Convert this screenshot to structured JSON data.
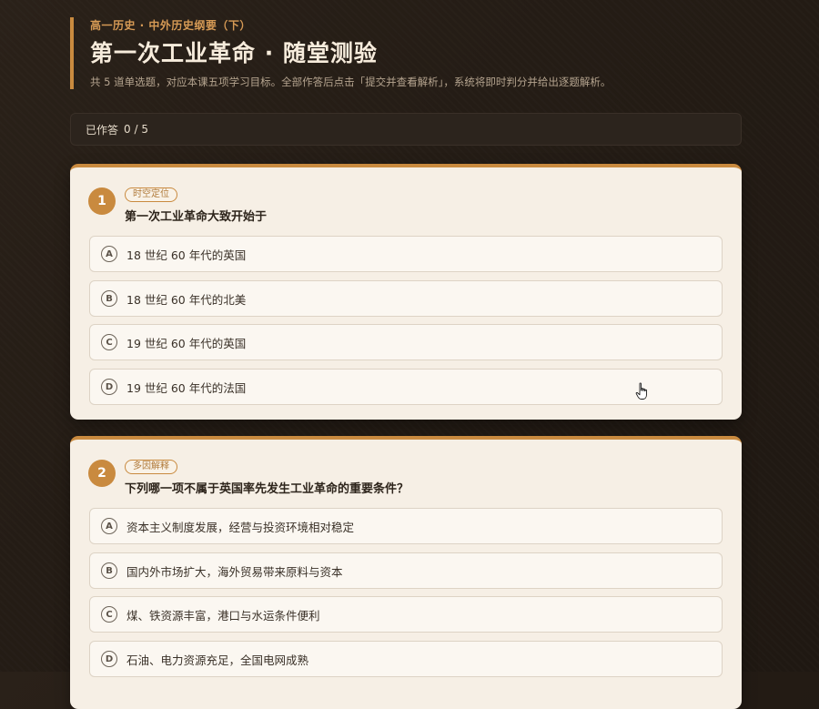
{
  "header": {
    "course": "高一历史 · 中外历史纲要（下）",
    "title": "第一次工业革命 · 随堂测验",
    "subtitle": "共 5 道单选题，对应本课五项学习目标。全部作答后点击「提交并查看解析」，系统将即时判分并给出逐题解析。"
  },
  "progress": {
    "label": "已作答",
    "value": "0 / 5"
  },
  "questions": [
    {
      "number": "1",
      "tag": "时空定位",
      "text": "第一次工业革命大致开始于",
      "options": [
        {
          "letter": "A",
          "text": "18 世纪 60 年代的英国"
        },
        {
          "letter": "B",
          "text": "18 世纪 60 年代的北美"
        },
        {
          "letter": "C",
          "text": "19 世纪 60 年代的英国"
        },
        {
          "letter": "D",
          "text": "19 世纪 60 年代的法国"
        }
      ]
    },
    {
      "number": "2",
      "tag": "多因解释",
      "text": "下列哪一项不属于英国率先发生工业革命的重要条件？",
      "options": [
        {
          "letter": "A",
          "text": "资本主义制度发展，经营与投资环境相对稳定"
        },
        {
          "letter": "B",
          "text": "国内外市场扩大，海外贸易带来原料与资本"
        },
        {
          "letter": "C",
          "text": "煤、铁资源丰富，港口与水运条件便利"
        },
        {
          "letter": "D",
          "text": "石油、电力资源充足，全国电网成熟"
        }
      ]
    }
  ],
  "colors": {
    "accent": "#c98a3f",
    "background": "#241c15",
    "card": "#f6efe5"
  }
}
